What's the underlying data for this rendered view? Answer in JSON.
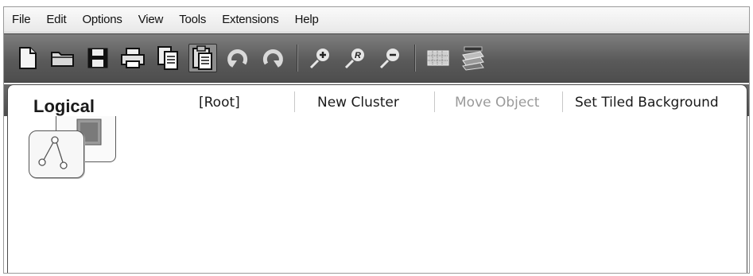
{
  "menubar": {
    "items": [
      "File",
      "Edit",
      "Options",
      "View",
      "Tools",
      "Extensions",
      "Help"
    ]
  },
  "toolbar": {
    "buttons": [
      {
        "icon": "new-file-icon"
      },
      {
        "icon": "open-folder-icon"
      },
      {
        "icon": "save-icon"
      },
      {
        "icon": "print-icon"
      },
      {
        "icon": "copy-icon"
      },
      {
        "icon": "paste-icon",
        "pressed": true
      },
      {
        "icon": "undo-icon"
      },
      {
        "icon": "redo-icon"
      },
      {
        "icon": "zoom-in-icon"
      },
      {
        "icon": "zoom-reset-icon",
        "glyph": "R"
      },
      {
        "icon": "zoom-out-icon"
      },
      {
        "icon": "grid-icon"
      },
      {
        "icon": "layers-icon"
      }
    ]
  },
  "tab": {
    "title": "Logical",
    "actions": {
      "root": "[Root]",
      "new_cluster": "New Cluster",
      "move_object": "Move Object",
      "set_tiled_background": "Set Tiled Background"
    }
  },
  "colors": {
    "toolbar_bg": "#5a5a5a",
    "disabled_text": "#9a9a9a",
    "text": "#1a1a1a"
  }
}
